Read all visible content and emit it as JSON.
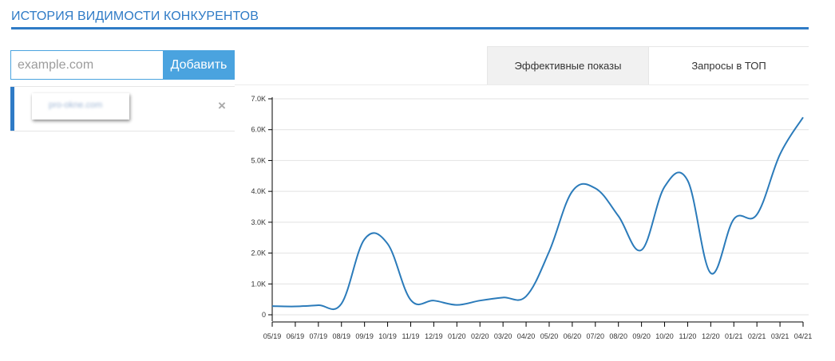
{
  "header": {
    "title": "ИСТОРИЯ ВИДИМОСТИ КОНКУРЕНТОВ"
  },
  "add_form": {
    "placeholder": "example.com",
    "value": "",
    "button_label": "Добавить"
  },
  "competitors": [
    {
      "domain": "pro-okne.com",
      "remove_icon": "×"
    }
  ],
  "tabs": [
    {
      "label": "Эффективные показы",
      "active": true
    },
    {
      "label": "Запросы в ТОП",
      "active": false
    }
  ],
  "colors": {
    "accent": "#2f7bc6",
    "button": "#4aa3df",
    "line": "#2b7bba"
  },
  "chart_data": {
    "type": "line",
    "title": "",
    "xlabel": "",
    "ylabel": "",
    "categories": [
      "05/19",
      "06/19",
      "07/19",
      "08/19",
      "09/19",
      "10/19",
      "11/19",
      "12/19",
      "01/20",
      "02/20",
      "03/20",
      "04/20",
      "05/20",
      "06/20",
      "07/20",
      "08/20",
      "09/20",
      "10/20",
      "11/20",
      "12/20",
      "01/21",
      "02/21",
      "03/21",
      "04/21"
    ],
    "series": [
      {
        "values": [
          280,
          270,
          310,
          360,
          2450,
          2300,
          480,
          460,
          320,
          460,
          560,
          600,
          2050,
          4000,
          4100,
          3200,
          2100,
          4150,
          4350,
          1350,
          3100,
          3250,
          5200,
          6400
        ]
      }
    ],
    "y_ticks": [
      0,
      1000,
      2000,
      3000,
      4000,
      5000,
      6000,
      7000
    ],
    "y_tick_labels": [
      "0",
      "1.0K",
      "2.0K",
      "3.0K",
      "4.0K",
      "5.0K",
      "6.0K",
      "7.0K"
    ],
    "ylim": [
      0,
      7000
    ],
    "grid": true,
    "legend": "none"
  }
}
